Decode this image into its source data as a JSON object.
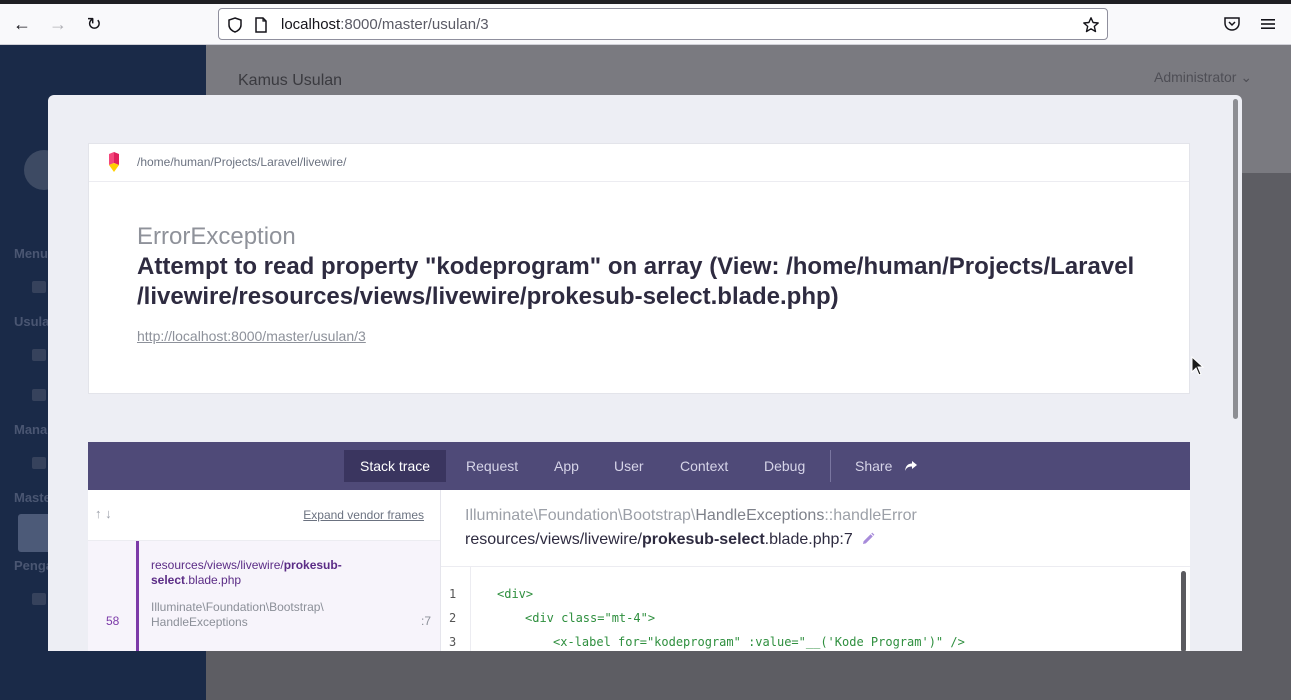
{
  "browser": {
    "url_host": "localhost",
    "url_path": ":8000/master/usulan/3"
  },
  "background_app": {
    "page_title": "Kamus Usulan",
    "user_menu": "Administrator",
    "sidebar_sections": [
      "Menu",
      "Usula",
      "Mana",
      "Maste",
      "Penga"
    ]
  },
  "error": {
    "app_path": "/home/human/Projects/Laravel/livewire/",
    "exception_class": "ErrorException",
    "message": "Attempt to read property \"kodeprogram\" on array (View: /home/human/Projects/Laravel /livewire/resources/views/livewire/prokesub-select.blade.php)",
    "url": "http://localhost:8000/master/usulan/3"
  },
  "tabs": [
    {
      "label": "Stack trace",
      "active": true
    },
    {
      "label": "Request",
      "active": false
    },
    {
      "label": "App",
      "active": false
    },
    {
      "label": "User",
      "active": false
    },
    {
      "label": "Context",
      "active": false
    },
    {
      "label": "Debug",
      "active": false
    },
    {
      "label": "Share",
      "active": false
    }
  ],
  "frames": {
    "expand_label": "Expand vendor frames",
    "items": [
      {
        "number": "58",
        "file_prefix": "resources/views/livewire/",
        "file_bold": "prokesub-select",
        "file_suffix": ".blade.php",
        "class_line1": "Illuminate\\Foundation\\Bootstrap\\",
        "class_line2": "HandleExceptions",
        "line": ":7"
      }
    ]
  },
  "detail": {
    "namespace": "Illuminate\\Foundation\\Bootstrap\\",
    "class": "HandleExceptions",
    "method": "::handleError",
    "file_prefix": "resources/views/livewire/",
    "file_bold": "prokesub-select",
    "file_suffix": ".blade.php:7"
  },
  "code": {
    "line_numbers": [
      "1",
      "2",
      "3"
    ],
    "line1": "<div>",
    "line2_tag": "<div ",
    "line2_attr": "class=",
    "line2_str": "\"mt-4\"",
    "line2_end": ">",
    "line3_tag": "<x-label ",
    "line3_attr": "for=",
    "line3_str": "\"kodeprogram\"",
    "line3_attr2": " :value=",
    "line3_str2": "\"__('Kode Program')\"",
    "line3_end": " />"
  }
}
